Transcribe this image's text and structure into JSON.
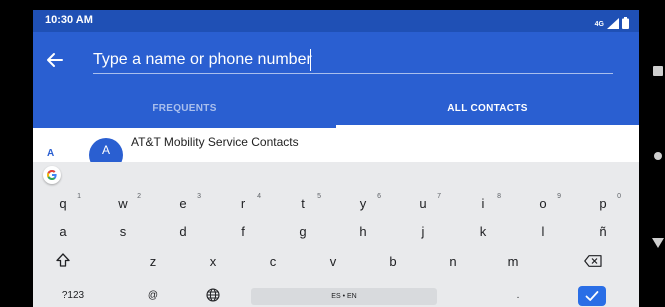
{
  "status": {
    "time": "10:30 AM",
    "network_label": "4G"
  },
  "search": {
    "placeholder": "Type a name or phone number"
  },
  "tabs": [
    {
      "label": "FREQUENTS"
    },
    {
      "label": "ALL CONTACTS"
    }
  ],
  "contacts": {
    "section_letter": "A",
    "items": [
      {
        "avatar_letter": "A",
        "name": "AT&T Mobility Service Contacts"
      }
    ]
  },
  "keyboard": {
    "rows": [
      [
        {
          "k": "q",
          "h": "1"
        },
        {
          "k": "w",
          "h": "2"
        },
        {
          "k": "e",
          "h": "3"
        },
        {
          "k": "r",
          "h": "4"
        },
        {
          "k": "t",
          "h": "5"
        },
        {
          "k": "y",
          "h": "6"
        },
        {
          "k": "u",
          "h": "7"
        },
        {
          "k": "i",
          "h": "8"
        },
        {
          "k": "o",
          "h": "9"
        },
        {
          "k": "p",
          "h": "0"
        }
      ],
      [
        {
          "k": "a"
        },
        {
          "k": "s"
        },
        {
          "k": "d"
        },
        {
          "k": "f"
        },
        {
          "k": "g"
        },
        {
          "k": "h"
        },
        {
          "k": "j"
        },
        {
          "k": "k"
        },
        {
          "k": "l"
        },
        {
          "k": "ñ"
        }
      ],
      [
        {
          "k": "z"
        },
        {
          "k": "x"
        },
        {
          "k": "c"
        },
        {
          "k": "v"
        },
        {
          "k": "b"
        },
        {
          "k": "n"
        },
        {
          "k": "m"
        }
      ]
    ],
    "symbols_label": "?123",
    "at_label": "@",
    "space_label": "ES • EN",
    "period_label": "."
  },
  "colors": {
    "accent": "#2a5fd1",
    "status_bar": "#1f50b5",
    "enter": "#2a6ee6"
  },
  "icons": [
    "back-arrow-icon",
    "signal-icon",
    "battery-icon",
    "google-g-icon",
    "shift-icon",
    "backspace-icon",
    "globe-icon",
    "check-icon",
    "nav-back-icon",
    "nav-home-icon",
    "nav-recents-icon"
  ]
}
